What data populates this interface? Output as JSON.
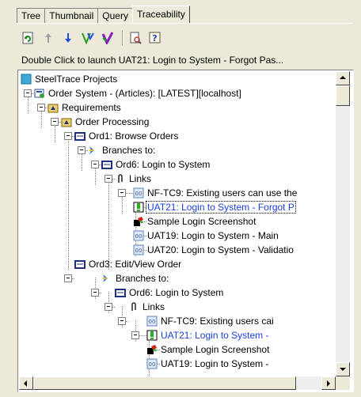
{
  "tabs": [
    {
      "label": "Tree"
    },
    {
      "label": "Thumbnail"
    },
    {
      "label": "Query"
    },
    {
      "label": "Traceability"
    }
  ],
  "toolbar": {
    "icons": [
      "refresh-icon",
      "arrow-up-icon",
      "arrow-down-icon",
      "trace-branch-icon",
      "trace-check-icon",
      "properties-icon",
      "help-icon"
    ]
  },
  "hint": "Double Click to launch UAT21: Login to System - Forgot Pas...",
  "tree": [
    {
      "label": "SteelTrace Projects"
    },
    {
      "label": "Order System - (Articles): [LATEST][localhost]"
    },
    {
      "label": "Requirements"
    },
    {
      "label": "Order Processing"
    },
    {
      "label": "Ord1: Browse Orders"
    },
    {
      "label": "Branches to:"
    },
    {
      "label": "Ord6: Login to System"
    },
    {
      "label": "Links"
    },
    {
      "label": "NF-TC9: Existing users can use the"
    },
    {
      "label": "UAT21: Login to System - Forgot P"
    },
    {
      "label": "Sample Login Screenshot"
    },
    {
      "label": "UAT19: Login to System - Main"
    },
    {
      "label": "UAT20: Login to System - Validatio"
    },
    {
      "label": "Ord3: Edit/View Order"
    },
    {
      "label": "Branches to:"
    },
    {
      "label": "Ord6: Login to System"
    },
    {
      "label": "Links"
    },
    {
      "label": "NF-TC9: Existing users cai"
    },
    {
      "label": "UAT21: Login to System -"
    },
    {
      "label": "Sample Login Screenshot"
    },
    {
      "label": "UAT19: Login to System -"
    }
  ]
}
